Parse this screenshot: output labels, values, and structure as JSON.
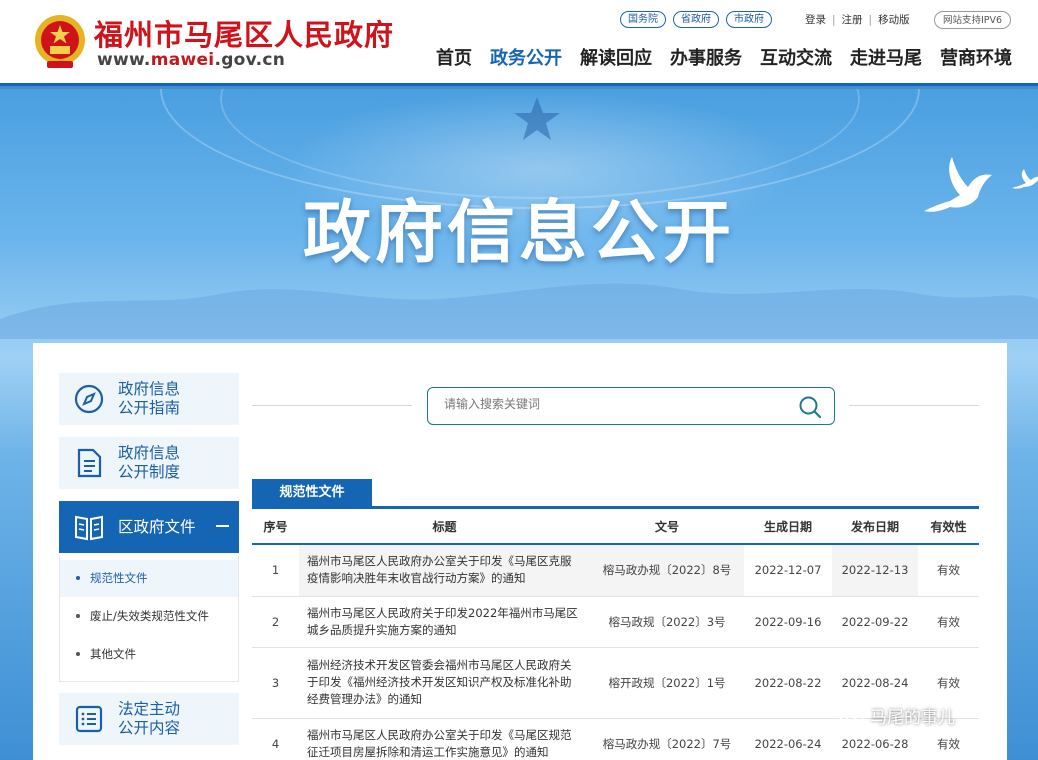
{
  "header": {
    "site_name": "福州市马尾区人民政府",
    "url_prefix": "www.",
    "url_domain": "mawei",
    "url_suffix": ".gov.cn",
    "top_links": [
      "国务院",
      "省政府",
      "市政府"
    ],
    "user_links": [
      "登录",
      "注册",
      "移动版"
    ],
    "ipv6_label": "网站支持IPV6",
    "nav": [
      {
        "label": "首页",
        "active": false
      },
      {
        "label": "政务公开",
        "active": true
      },
      {
        "label": "解读回应",
        "active": false
      },
      {
        "label": "办事服务",
        "active": false
      },
      {
        "label": "互动交流",
        "active": false
      },
      {
        "label": "走进马尾",
        "active": false
      },
      {
        "label": "营商环境",
        "active": false
      }
    ]
  },
  "banner": {
    "title": "政府信息公开"
  },
  "sidebar": {
    "items": [
      {
        "label": "政府信息\n公开指南",
        "icon": "compass-icon"
      },
      {
        "label": "政府信息\n公开制度",
        "icon": "document-icon"
      },
      {
        "label": "区政府文件",
        "icon": "book-icon",
        "active": true
      },
      {
        "label": "法定主动\n公开内容",
        "icon": "list-icon"
      }
    ],
    "submenu": [
      {
        "label": "规范性文件",
        "active": true
      },
      {
        "label": "废止/失效类规范性文件",
        "active": false
      },
      {
        "label": "其他文件",
        "active": false
      }
    ]
  },
  "search": {
    "placeholder": "请输入搜索关键词",
    "value": ""
  },
  "table": {
    "tab_label": "规范性文件",
    "columns": [
      "序号",
      "标题",
      "文号",
      "生成日期",
      "发布日期",
      "有效性"
    ],
    "rows": [
      {
        "no": "1",
        "title": "福州市马尾区人民政府办公室关于印发《马尾区克服疫情影响决胜年末收官战行动方案》的通知",
        "doc_no": "榕马政办规〔2022〕8号",
        "created": "2022-12-07",
        "published": "2022-12-13",
        "validity": "有效"
      },
      {
        "no": "2",
        "title": "福州市马尾区人民政府关于印发2022年福州市马尾区城乡品质提升实施方案的通知",
        "doc_no": "榕马政规〔2022〕3号",
        "created": "2022-09-16",
        "published": "2022-09-22",
        "validity": "有效"
      },
      {
        "no": "3",
        "title": "福州经济技术开发区管委会福州市马尾区人民政府关于印发《福州经济技术开发区知识产权及标准化补助经费管理办法》的通知",
        "doc_no": "榕开政规〔2022〕1号",
        "created": "2022-08-22",
        "published": "2022-08-24",
        "validity": "有效"
      },
      {
        "no": "4",
        "title": "福州市马尾区人民政府办公室关于印发《马尾区规范征迁项目房屋拆除和清运工作实施意见》的通知",
        "doc_no": "榕马政办规〔2022〕7号",
        "created": "2022-06-24",
        "published": "2022-06-28",
        "validity": "有效"
      }
    ]
  },
  "watermark": {
    "text": "马尾的事儿"
  },
  "colors": {
    "brand_blue": "#1565b5",
    "brand_red": "#d0121b",
    "side_bg": "#eef5fb"
  }
}
